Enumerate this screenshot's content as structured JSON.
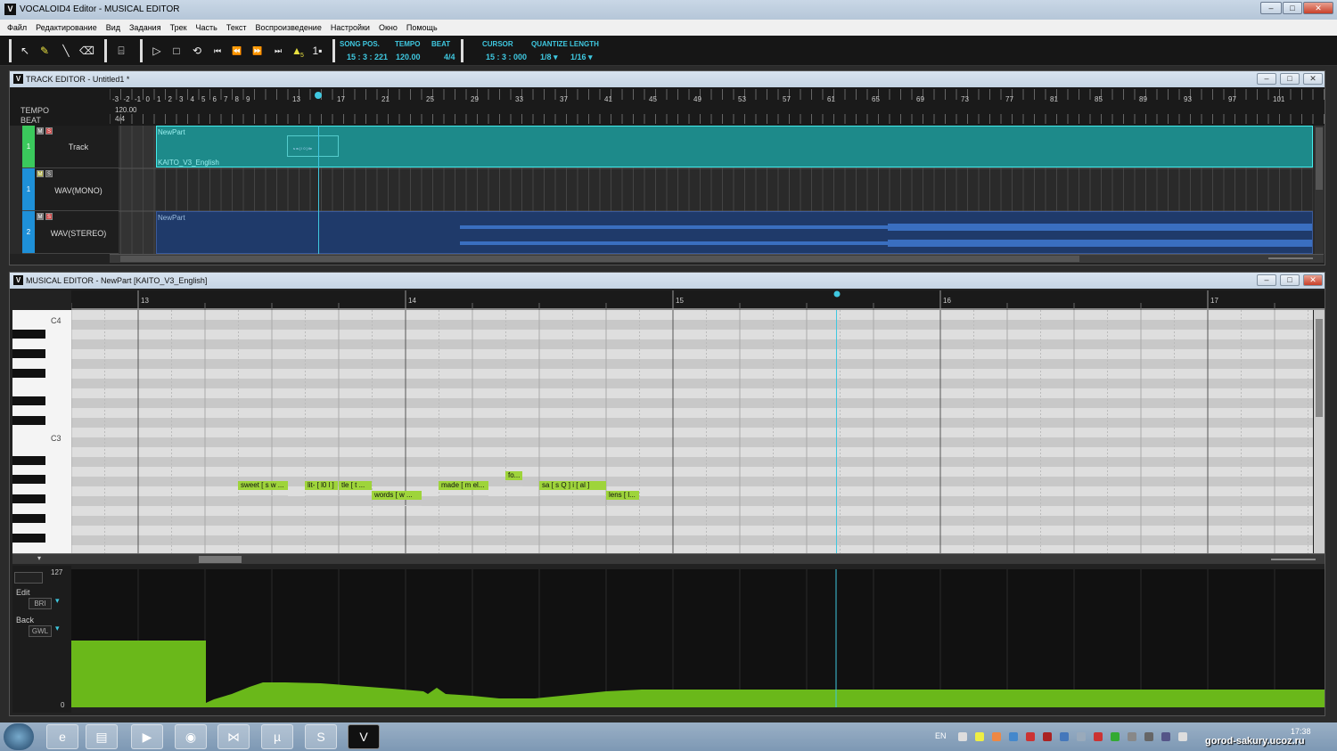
{
  "window": {
    "title": "VOCALOID4 Editor - MUSICAL EDITOR",
    "logo": "V"
  },
  "menu": [
    "Файл",
    "Редактирование",
    "Вид",
    "Задания",
    "Трек",
    "Часть",
    "Текст",
    "Воспроизведение",
    "Настройки",
    "Окно",
    "Помощь"
  ],
  "toolbar": {
    "song_pos_label": "SONG POS.",
    "song_pos_value": "15 : 3 : 221",
    "tempo_label": "TEMPO",
    "tempo_value": "120.00",
    "beat_label": "BEAT",
    "beat_value": "4/4",
    "cursor_label": "CURSOR",
    "cursor_value": "15 : 3 : 000",
    "quantize_label": "QUANTIZE",
    "quantize_value": "1/8",
    "length_label": "LENGTH",
    "length_value": "1/16",
    "icons": [
      "pointer-icon",
      "pencil-icon",
      "line-icon",
      "eraser-icon",
      "realtime-icon",
      "play-icon",
      "stop-icon",
      "loop-icon",
      "goto-start-icon",
      "rewind-icon",
      "fast-forward-icon",
      "goto-end-icon",
      "metronome-icon",
      "count-in-icon"
    ],
    "metronome_sub": "5",
    "count_in": "1"
  },
  "track_editor": {
    "title": "TRACK EDITOR - Untitled1 *",
    "tempo_label": "TEMPO",
    "tempo_value": "120.00",
    "beat_label": "BEAT",
    "beat_value": "4/4",
    "ruler_negative": [
      "-3",
      "-2",
      "-1",
      "0",
      "1",
      "2",
      "3",
      "4",
      "5",
      "6",
      "7",
      "8",
      "9"
    ],
    "ruler": [
      "13",
      "17",
      "21",
      "25",
      "29",
      "33",
      "37",
      "41",
      "45",
      "49",
      "53",
      "57",
      "61",
      "65",
      "69",
      "73",
      "77",
      "81",
      "85",
      "89",
      "93",
      "97",
      "101"
    ],
    "tracks": [
      {
        "num": "1",
        "name": "Track",
        "part": "NewPart",
        "singer": "KAITO_V3_English",
        "mini": "s w [ l 0 ] tle"
      },
      {
        "num": "1",
        "name": "WAV(MONO)"
      },
      {
        "num": "2",
        "name": "WAV(STEREO)",
        "part": "NewPart"
      }
    ],
    "mute": "M",
    "solo": "S"
  },
  "musical_editor": {
    "title": "MUSICAL EDITOR - NewPart [KAITO_V3_English]",
    "ruler": [
      "13",
      "14",
      "15",
      "16",
      "17"
    ],
    "octaves": [
      "C4",
      "C3"
    ],
    "notes": [
      {
        "text": "sweet [ s w ..."
      },
      {
        "text": "lit- [ l0 l ]"
      },
      {
        "text": "tle [ t ..."
      },
      {
        "text": "words [ w ..."
      },
      {
        "text": "made [ m el..."
      },
      {
        "text": "fo..."
      },
      {
        "text": "sa [ s Q ] i [ al ]"
      },
      {
        "text": "lens [ l..."
      }
    ]
  },
  "control_track": {
    "max": "127",
    "min": "0",
    "edit_label": "Edit",
    "edit_value": "BRI",
    "back_label": "Back",
    "back_value": "GWL"
  },
  "taskbar": {
    "apps": [
      "windows-start",
      "internet-explorer",
      "file-explorer",
      "media-player",
      "chrome",
      "visual-studio",
      "utorrent",
      "skype",
      "vocaloid"
    ],
    "lang": "EN",
    "time": "17:38",
    "watermark": "gorod-sakury.ucoz.ru"
  }
}
